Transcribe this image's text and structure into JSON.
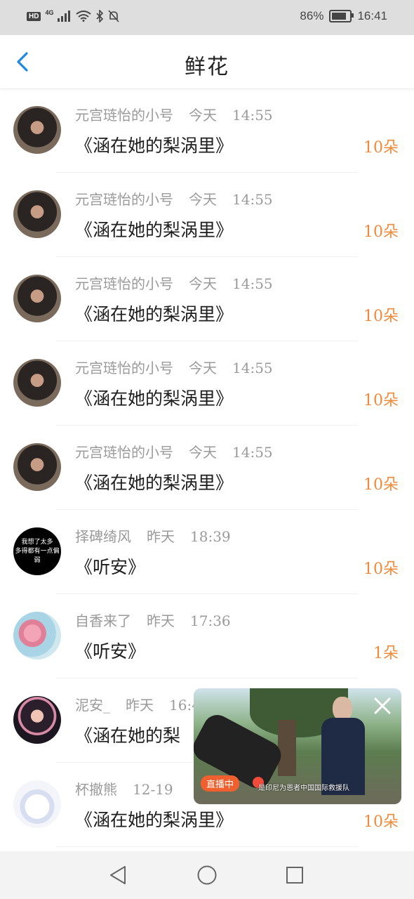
{
  "status_bar": {
    "hd": "HD",
    "network": "4G",
    "battery_percent": "86%",
    "time": "16:41"
  },
  "header": {
    "title": "鲜花"
  },
  "rows": [
    {
      "name": "元宫琏怡的小号",
      "day": "今天",
      "time": "14:55",
      "song": "《涵在她的梨涡里》",
      "count": "10朵"
    },
    {
      "name": "元宫琏怡的小号",
      "day": "今天",
      "time": "14:55",
      "song": "《涵在她的梨涡里》",
      "count": "10朵"
    },
    {
      "name": "元宫琏怡的小号",
      "day": "今天",
      "time": "14:55",
      "song": "《涵在她的梨涡里》",
      "count": "10朵"
    },
    {
      "name": "元宫琏怡的小号",
      "day": "今天",
      "time": "14:55",
      "song": "《涵在她的梨涡里》",
      "count": "10朵"
    },
    {
      "name": "元宫琏怡的小号",
      "day": "今天",
      "time": "14:55",
      "song": "《涵在她的梨涡里》",
      "count": "10朵"
    },
    {
      "name": "择碑绮风",
      "day": "昨天",
      "time": "18:39",
      "song": "《听安》",
      "count": "10朵",
      "avatar_line1": "我想了太多",
      "avatar_line2": "多得都有一点偏弱"
    },
    {
      "name": "自香来了",
      "day": "昨天",
      "time": "17:36",
      "song": "《听安》",
      "count": "1朵"
    },
    {
      "name": "泥安_",
      "day": "昨天",
      "time": "16:4",
      "song": "《涵在她的梨",
      "count": ""
    },
    {
      "name": "杯撤熊",
      "day": "12-19",
      "time": "",
      "song": "《涵在她的梨涡里》",
      "count": "10朵"
    }
  ],
  "video": {
    "live_label": "直播中",
    "caption": "是印尼为恩者中国国际救援队"
  },
  "colors": {
    "accent": "#1e88e5",
    "count": "#ef8a3a",
    "meta": "#9a9a9a"
  }
}
